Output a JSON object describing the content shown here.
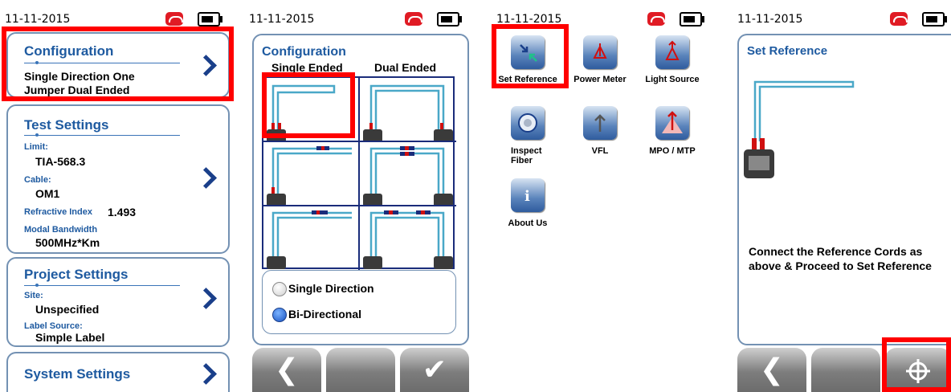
{
  "status": {
    "date": "11-11-2015"
  },
  "screen1": {
    "configuration": {
      "title": "Configuration",
      "line1": "Single Direction One",
      "line2": "Jumper Dual Ended"
    },
    "test_settings": {
      "title": "Test Settings",
      "limit_key": "Limit:",
      "limit_val": "TIA-568.3",
      "cable_key": "Cable:",
      "cable_val": "OM1",
      "ri_key": "Refractive Index",
      "ri_val": "1.493",
      "mb_key": "Modal Bandwidth",
      "mb_val": "500MHz*Km"
    },
    "project_settings": {
      "title": "Project Settings",
      "site_key": "Site:",
      "site_val": "Unspecified",
      "label_key": "Label Source:",
      "label_val": "Simple Label"
    },
    "system_settings": {
      "title": "System Settings"
    }
  },
  "screen2": {
    "title": "Configuration",
    "col_single": "Single Ended",
    "col_dual": "Dual Ended",
    "radio_single": "Single Direction",
    "radio_bi": "Bi-Directional",
    "selected": "Bi-Directional"
  },
  "screen3": {
    "apps": [
      {
        "label": "Set Reference",
        "icon": "set-reference-icon"
      },
      {
        "label": "Power Meter",
        "icon": "power-meter-icon"
      },
      {
        "label": "Light Source",
        "icon": "light-source-icon"
      },
      {
        "label": "Inspect Fiber",
        "icon": "inspect-fiber-icon"
      },
      {
        "label": "VFL",
        "icon": "vfl-icon"
      },
      {
        "label": "MPO / MTP",
        "icon": "mpo-mtp-icon"
      },
      {
        "label": "About Us",
        "icon": "about-us-icon"
      }
    ]
  },
  "screen4": {
    "title": "Set Reference",
    "message": "Connect the Reference Cords as above & Proceed to Set Reference"
  },
  "nav": {
    "back": "❮",
    "ok": "✔",
    "target": "⌖"
  },
  "colors": {
    "accent": "#1e5aa0",
    "highlight": "#ff0000",
    "border": "#7391b3"
  }
}
